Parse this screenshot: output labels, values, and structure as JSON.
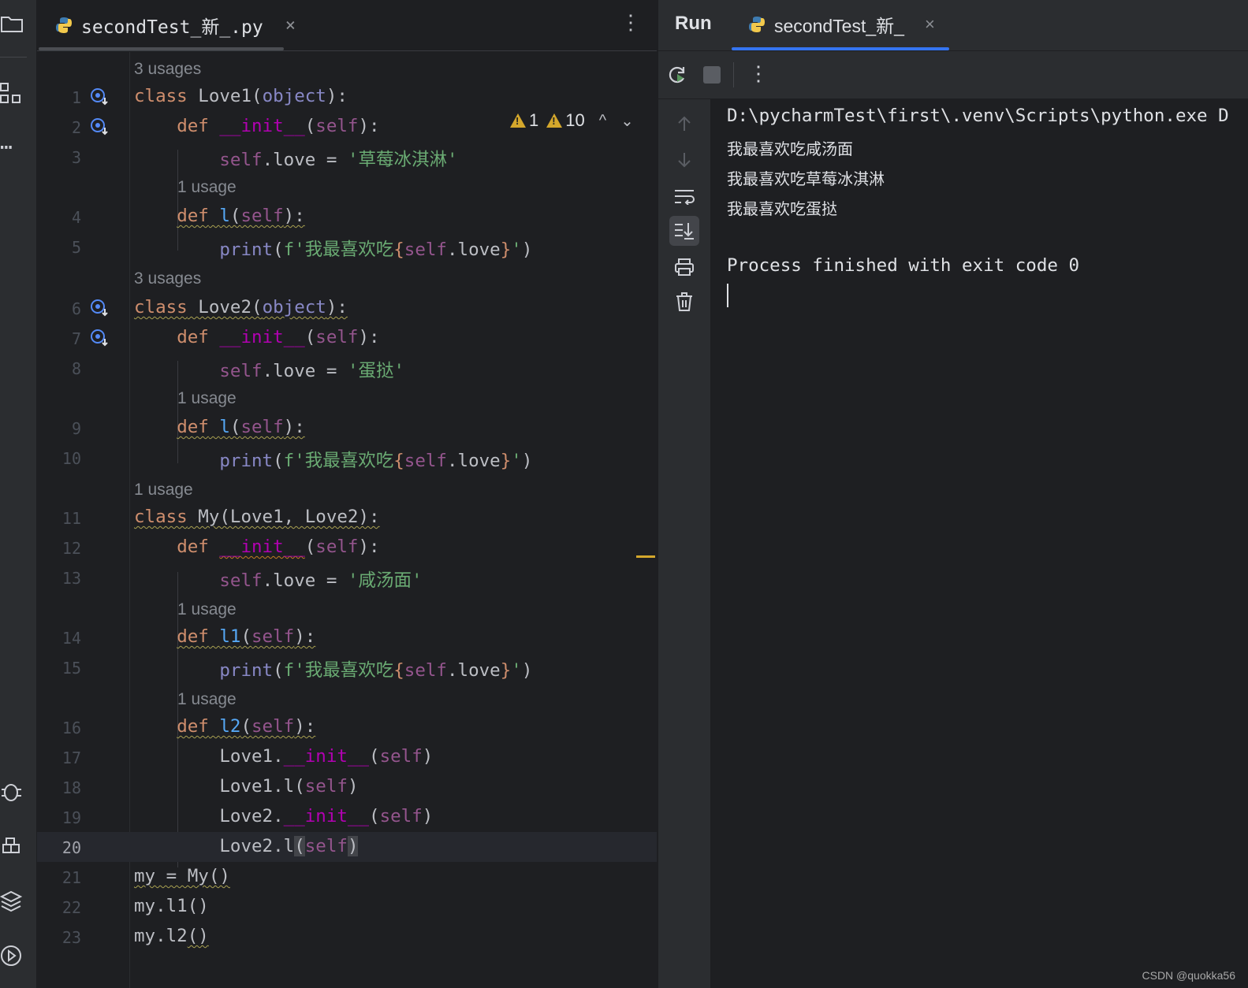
{
  "editor": {
    "tab_label": "secondTest_新_.py",
    "tab_close": "×",
    "menu": "⋮",
    "inspection": {
      "errors": "1",
      "warnings": "10",
      "prev": "^",
      "next": "⌄"
    },
    "hints": {
      "h0": "3 usages",
      "h3": "1 usage",
      "h5": "3 usages",
      "h8": "1 usage",
      "h10": "1 usage",
      "h13": "1 usage",
      "h15": "1 usage"
    },
    "line_numbers": [
      "1",
      "2",
      "3",
      "4",
      "5",
      "6",
      "7",
      "8",
      "9",
      "10",
      "11",
      "12",
      "13",
      "14",
      "15",
      "16",
      "17",
      "18",
      "19",
      "20",
      "21",
      "22",
      "23"
    ],
    "current_line": "20",
    "strings": {
      "s3": "'草莓冰淇淋'",
      "s5a": "f'我最喜欢吃",
      "s8": "'蛋挞'",
      "s13": "'咸汤面'"
    }
  },
  "run": {
    "title": "Run",
    "tab_label": "secondTest_新_",
    "tab_close": "×",
    "menu": "⋮",
    "console": [
      "D:\\pycharmTest\\first\\.venv\\Scripts\\python.exe D",
      "我最喜欢吃咸汤面",
      "我最喜欢吃草莓冰淇淋",
      "我最喜欢吃蛋挞",
      "",
      "Process finished with exit code 0"
    ]
  },
  "watermark": "CSDN @quokka56",
  "colors": {
    "keyword": "#cf8e6d",
    "function": "#56a8f5",
    "dunder": "#b200b2",
    "self": "#94558d",
    "string": "#6aab73",
    "accent": "#3574f0",
    "warning": "#d4a72c"
  }
}
